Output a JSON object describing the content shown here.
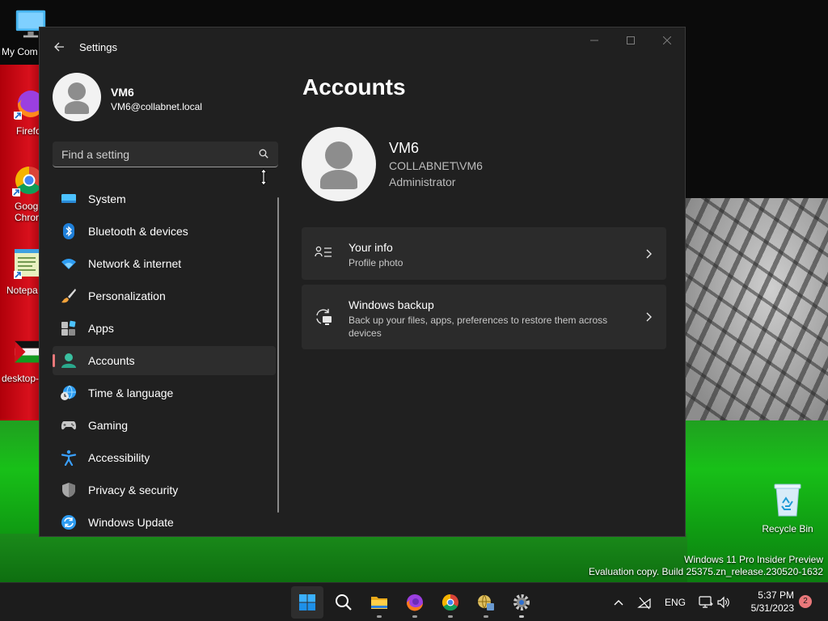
{
  "desktop": {
    "icons": [
      {
        "label": "My Com"
      },
      {
        "label": "Firefo"
      },
      {
        "label": "Goog"
      },
      {
        "label": "Chron"
      },
      {
        "label": "Notepa"
      },
      {
        "label": "desktop-"
      },
      {
        "label": "Recycle Bin"
      }
    ],
    "watermark": {
      "line1": "Windows 11 Pro Insider Preview",
      "line2": "Evaluation copy. Build 25375.zn_release.230520-1632"
    }
  },
  "window": {
    "title": "Settings",
    "controls": {
      "minimize": "—",
      "maximize": "☐",
      "close": "✕"
    }
  },
  "sidebar": {
    "profile": {
      "name": "VM6",
      "email": "VM6@collabnet.local"
    },
    "search": {
      "placeholder": "Find a setting"
    },
    "items": [
      {
        "label": "System",
        "icon": "system-icon"
      },
      {
        "label": "Bluetooth & devices",
        "icon": "bluetooth-icon"
      },
      {
        "label": "Network & internet",
        "icon": "wifi-icon"
      },
      {
        "label": "Personalization",
        "icon": "brush-icon"
      },
      {
        "label": "Apps",
        "icon": "apps-icon"
      },
      {
        "label": "Accounts",
        "icon": "accounts-icon",
        "active": true
      },
      {
        "label": "Time & language",
        "icon": "clock-globe-icon"
      },
      {
        "label": "Gaming",
        "icon": "gamepad-icon"
      },
      {
        "label": "Accessibility",
        "icon": "accessibility-icon"
      },
      {
        "label": "Privacy & security",
        "icon": "shield-icon"
      },
      {
        "label": "Windows Update",
        "icon": "update-icon"
      }
    ]
  },
  "main": {
    "title": "Accounts",
    "user": {
      "name": "VM6",
      "domain": "COLLABNET\\VM6",
      "role": "Administrator"
    },
    "cards": [
      {
        "title": "Your info",
        "subtitle": "Profile photo",
        "icon": "your-info-icon"
      },
      {
        "title": "Windows backup",
        "subtitle": "Back up your files, apps, preferences to restore them across devices",
        "icon": "backup-icon"
      }
    ]
  },
  "taskbar": {
    "apps": [
      "start",
      "search",
      "file-explorer",
      "firefox",
      "chrome",
      "network-app",
      "settings"
    ],
    "tray": {
      "language": "ENG",
      "time": "5:37 PM",
      "date": "5/31/2023",
      "notifications": "2"
    }
  },
  "colors": {
    "accent": "#e9787a",
    "window_bg": "#202020",
    "card_bg": "#2b2b2b",
    "taskbar_bg": "#1c1c1c"
  }
}
